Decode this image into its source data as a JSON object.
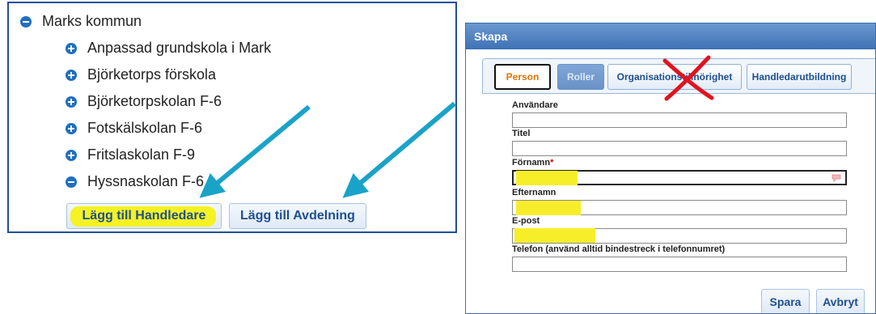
{
  "tree": {
    "root": "Marks kommun",
    "items": [
      {
        "label": "Anpassad grundskola i Mark",
        "icon": "plus-circle-icon"
      },
      {
        "label": "Björketorps förskola",
        "icon": "plus-circle-icon"
      },
      {
        "label": "Björketorpskolan F-6",
        "icon": "plus-circle-icon"
      },
      {
        "label": "Fotskälskolan F-6",
        "icon": "plus-circle-icon"
      },
      {
        "label": "Fritslaskolan F-9",
        "icon": "plus-circle-icon"
      },
      {
        "label": "Hyssnaskolan F-6",
        "icon": "minus-circle-icon"
      }
    ],
    "buttons": {
      "add_supervisor": "Lägg till Handledare",
      "add_department": "Lägg till Avdelning"
    }
  },
  "dialog": {
    "title": "Skapa",
    "tabs": [
      "Person",
      "Roller",
      "Organisationstillhörighet",
      "Handledarutbildning"
    ],
    "active_tab": "Person",
    "fields": [
      {
        "label": "Användare",
        "required": false,
        "value": ""
      },
      {
        "label": "Titel",
        "required": false,
        "value": ""
      },
      {
        "label": "Förnamn",
        "required": true,
        "value": ""
      },
      {
        "label": "Efternamn",
        "required": false,
        "value": ""
      },
      {
        "label": "E-post",
        "required": false,
        "value": ""
      },
      {
        "label": "Telefon (använd alltid bindestreck i telefonnumret)",
        "required": false,
        "value": ""
      }
    ],
    "required_marker": "*",
    "buttons": {
      "save": "Spara",
      "cancel": "Avbryt"
    }
  },
  "colors": {
    "highlight": "#f5f224",
    "arrow": "#1aa3c8",
    "cross": "#e0141e",
    "active_tab_text": "#e07400"
  }
}
